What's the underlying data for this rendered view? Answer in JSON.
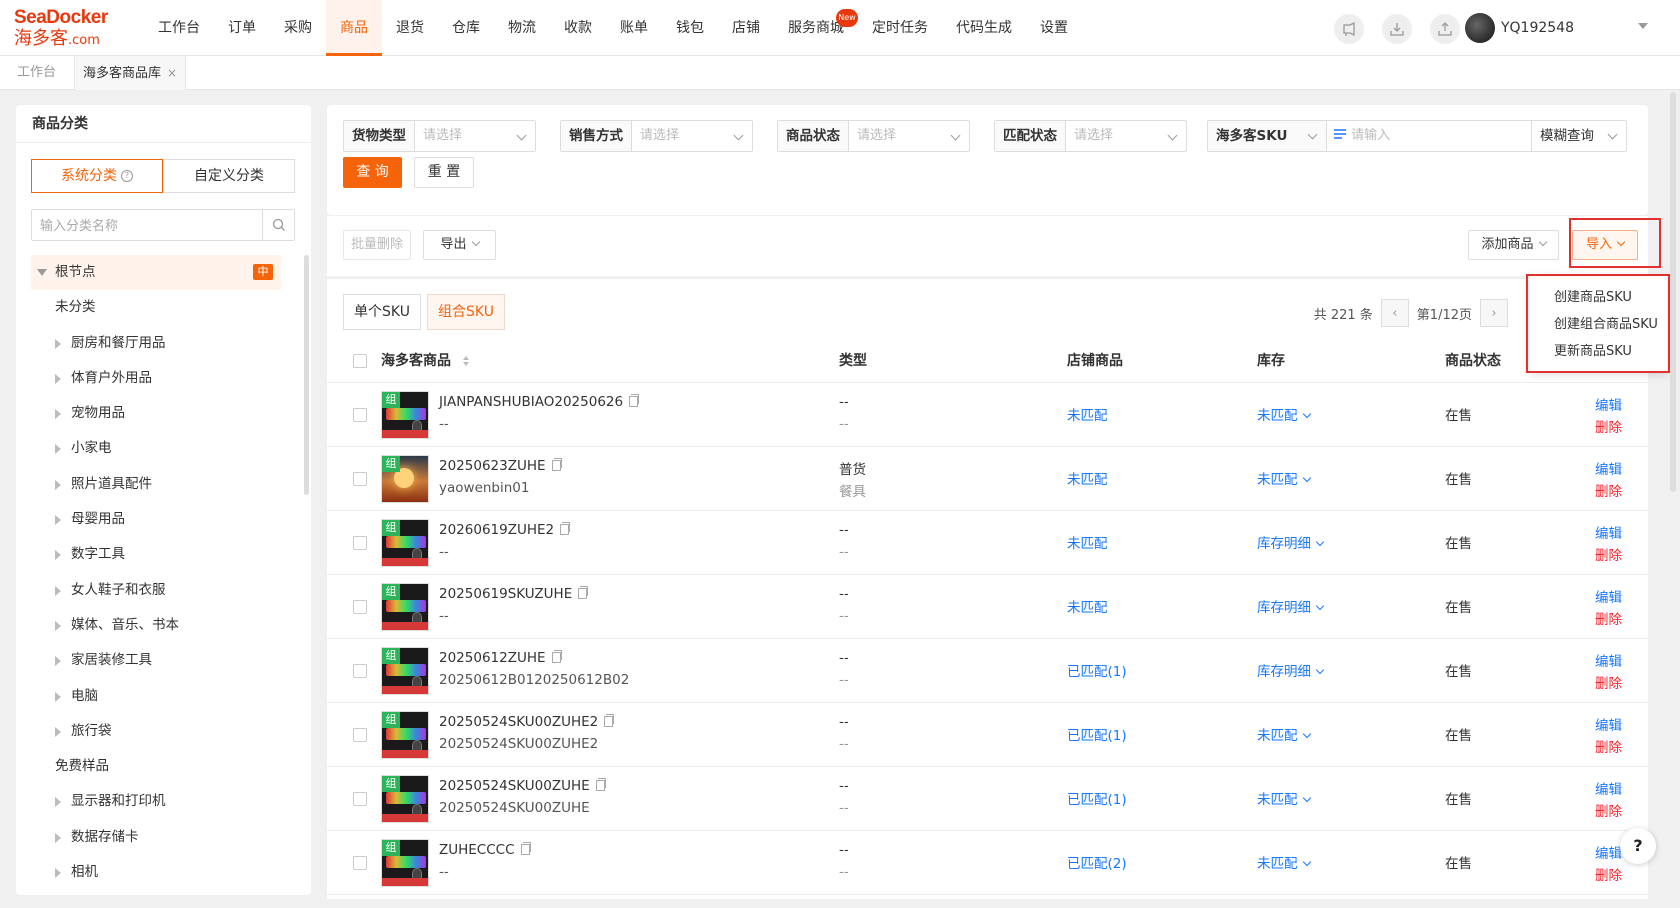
{
  "brand": {
    "logo_en": "SeaDocker",
    "logo_cn": "海多客",
    "logo_domain": ".com"
  },
  "nav": {
    "items": [
      "工作台",
      "订单",
      "采购",
      "商品",
      "退货",
      "仓库",
      "物流",
      "收款",
      "账单",
      "钱包",
      "店铺",
      "服务商城",
      "定时任务",
      "代码生成",
      "设置"
    ],
    "active_index": 3,
    "badge_text": "New"
  },
  "user": {
    "name": "YQ192548"
  },
  "tabs": {
    "home": "工作台",
    "current": "海多客商品库",
    "close": "×"
  },
  "category": {
    "title": "商品分类",
    "seg_system": "系统分类",
    "seg_custom": "自定义分类",
    "search_placeholder": "输入分类名称",
    "root": "根节点",
    "root_tag": "中",
    "items": [
      {
        "label": "未分类",
        "level": 1,
        "expandable": false
      },
      {
        "label": "厨房和餐厅用品",
        "level": 2,
        "expandable": true
      },
      {
        "label": "体育户外用品",
        "level": 2,
        "expandable": true
      },
      {
        "label": "宠物用品",
        "level": 2,
        "expandable": true
      },
      {
        "label": "小家电",
        "level": 2,
        "expandable": true
      },
      {
        "label": "照片道具配件",
        "level": 2,
        "expandable": true
      },
      {
        "label": "母婴用品",
        "level": 2,
        "expandable": true
      },
      {
        "label": "数字工具",
        "level": 2,
        "expandable": true
      },
      {
        "label": "女人鞋子和衣服",
        "level": 2,
        "expandable": true
      },
      {
        "label": "媒体、音乐、书本",
        "level": 2,
        "expandable": true
      },
      {
        "label": "家居装修工具",
        "level": 2,
        "expandable": true
      },
      {
        "label": "电脑",
        "level": 2,
        "expandable": true
      },
      {
        "label": "旅行袋",
        "level": 2,
        "expandable": true
      },
      {
        "label": "免费样品",
        "level": 1,
        "expandable": false
      },
      {
        "label": "显示器和打印机",
        "level": 2,
        "expandable": true
      },
      {
        "label": "数据存储卡",
        "level": 2,
        "expandable": true
      },
      {
        "label": "相机",
        "level": 2,
        "expandable": true
      }
    ]
  },
  "filters": {
    "goods_type": {
      "label": "货物类型",
      "placeholder": "请选择"
    },
    "sale_mode": {
      "label": "销售方式",
      "placeholder": "请选择"
    },
    "status": {
      "label": "商品状态",
      "placeholder": "请选择"
    },
    "match": {
      "label": "匹配状态",
      "placeholder": "请选择"
    },
    "sku_field": {
      "label": "海多客SKU",
      "placeholder": "请输入"
    },
    "fuzzy": "模糊查询",
    "query_btn": "查 询",
    "reset_btn": "重 置"
  },
  "toolbar": {
    "batch_delete": "批量删除",
    "export": "导出",
    "add_goods": "添加商品",
    "import": "导入"
  },
  "import_menu": [
    "创建商品SKU",
    "创建组合商品SKU",
    "更新商品SKU"
  ],
  "table": {
    "subtabs": [
      "单个SKU",
      "组合SKU"
    ],
    "active_subtab": 1,
    "total": "共 221 条",
    "page": "第1/12页",
    "headers": {
      "product": "海多客商品",
      "type": "类型",
      "store": "店铺商品",
      "stock": "库存",
      "status": "商品状态"
    },
    "edit": "编辑",
    "delete": "删除",
    "combo_tag": "组",
    "rows": [
      {
        "sku": "JIANPANSHUBIAO20250626",
        "sub": "--",
        "type1": "--",
        "type2": "--",
        "store": "未匹配",
        "stock": "未匹配",
        "status": "在售",
        "img": "kb"
      },
      {
        "sku": "20250623ZUHE",
        "sub": "yaowenbin01",
        "type1": "普货",
        "type2": "餐具",
        "store": "未匹配",
        "stock": "未匹配",
        "status": "在售",
        "img": "sunset"
      },
      {
        "sku": "20260619ZUHE2",
        "sub": "--",
        "type1": "--",
        "type2": "--",
        "store": "未匹配",
        "stock": "库存明细",
        "status": "在售",
        "img": "kb"
      },
      {
        "sku": "20250619SKUZUHE",
        "sub": "--",
        "type1": "--",
        "type2": "--",
        "store": "未匹配",
        "stock": "库存明细",
        "status": "在售",
        "img": "kb"
      },
      {
        "sku": "20250612ZUHE",
        "sub": "20250612B0120250612B02",
        "type1": "--",
        "type2": "--",
        "store": "已匹配(1)",
        "stock": "库存明细",
        "status": "在售",
        "img": "kb"
      },
      {
        "sku": "20250524SKU00ZUHE2",
        "sub": "20250524SKU00ZUHE2",
        "type1": "--",
        "type2": "--",
        "store": "已匹配(1)",
        "stock": "未匹配",
        "status": "在售",
        "img": "kb"
      },
      {
        "sku": "20250524SKU00ZUHE",
        "sub": "20250524SKU00ZUHE",
        "type1": "--",
        "type2": "--",
        "store": "已匹配(1)",
        "stock": "未匹配",
        "status": "在售",
        "img": "kb"
      },
      {
        "sku": "ZUHECCCC",
        "sub": "--",
        "type1": "--",
        "type2": "--",
        "store": "已匹配(2)",
        "stock": "未匹配",
        "status": "在售",
        "img": "kb"
      }
    ]
  },
  "help": "?",
  "colors": {
    "accent": "#f5640a",
    "link": "#1677ff",
    "danger": "#f5222d",
    "highlight": "#e0312c"
  }
}
